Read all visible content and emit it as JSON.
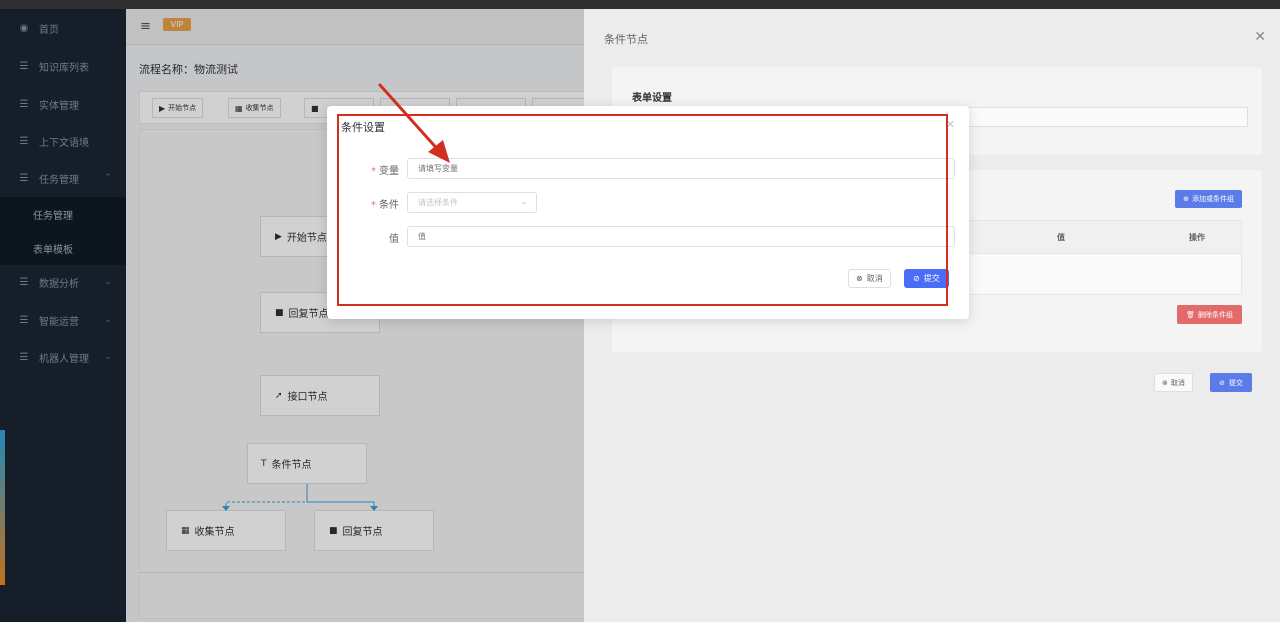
{
  "sidebar": {
    "items": [
      {
        "label": "首页",
        "icon": "dashboard-icon"
      },
      {
        "label": "知识库列表",
        "icon": "list-icon"
      },
      {
        "label": "实体管理",
        "icon": "list-icon"
      },
      {
        "label": "上下文语境",
        "icon": "list-icon"
      },
      {
        "label": "任务管理",
        "icon": "list-icon"
      },
      {
        "label": "数据分析",
        "icon": "list-icon"
      },
      {
        "label": "智能运营",
        "icon": "list-icon"
      },
      {
        "label": "机器人管理",
        "icon": "list-icon"
      }
    ],
    "sub_items": [
      {
        "label": "任务管理"
      },
      {
        "label": "表单模板"
      }
    ]
  },
  "header": {
    "vip_badge": "VIP"
  },
  "page": {
    "flow_title": "流程名称：物流测试",
    "toolbar": [
      {
        "label": "开始节点",
        "icon": "play-icon"
      },
      {
        "label": "收集节点",
        "icon": "form-icon"
      }
    ],
    "nodes": [
      {
        "label": "开始节点",
        "icon": "play-icon"
      },
      {
        "label": "回复节点",
        "icon": "chat-icon"
      },
      {
        "label": "接口节点",
        "icon": "api-icon"
      },
      {
        "label": "条件节点",
        "icon": "condition-icon"
      },
      {
        "label": "收集节点",
        "icon": "form-icon"
      },
      {
        "label": "回复节点",
        "icon": "chat-icon"
      }
    ]
  },
  "drawer": {
    "title": "条件节点",
    "form_card_title": "表单设置",
    "add_group_label": "添加或条件组",
    "table_headers": [
      "值",
      "操作"
    ],
    "delete_group_label": "删除条件组",
    "cancel_label": "取消",
    "submit_label": "提交"
  },
  "modal": {
    "title": "条件设置",
    "fields": {
      "variable": {
        "label": "变量",
        "placeholder": "请填写变量",
        "required": true
      },
      "condition": {
        "label": "条件",
        "placeholder": "请选择条件",
        "required": true
      },
      "value": {
        "label": "值",
        "placeholder": "值",
        "required": false
      }
    },
    "cancel_label": "取消",
    "submit_label": "提交"
  },
  "colors": {
    "sidebar_bg": "#1b2533",
    "primary": "#4a6cf7",
    "danger": "#e26a6a",
    "annotation": "#d22f1f",
    "vip": "#e8a24a"
  }
}
